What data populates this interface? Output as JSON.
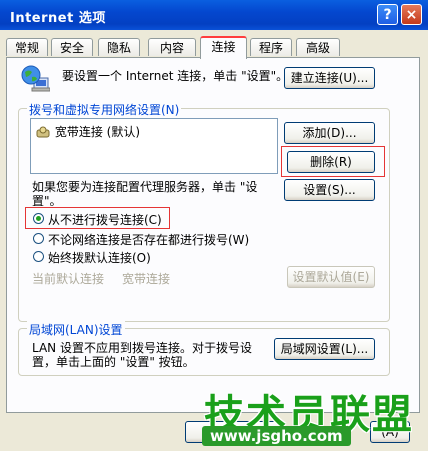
{
  "window": {
    "title": "Internet 选项",
    "help_label": "?",
    "close_label": "×"
  },
  "tabs": [
    {
      "label": "常规"
    },
    {
      "label": "安全"
    },
    {
      "label": "隐私"
    },
    {
      "label": "内容"
    },
    {
      "label": "连接"
    },
    {
      "label": "程序"
    },
    {
      "label": "高级"
    }
  ],
  "connect": {
    "setup_text": "要设置一个 Internet 连接，单击 \"设置\"。",
    "setup_button": "建立连接(U)..."
  },
  "dialup": {
    "group_label": "拨号和虚拟专用网络设置(N)",
    "items": [
      {
        "label": "宽带连接 (默认)"
      }
    ],
    "add_button": "添加(D)...",
    "delete_button": "删除(R)",
    "proxy_text_1": "如果您要为连接配置代理服务器，单击 \"设",
    "proxy_text_2": "置\"。",
    "settings_button": "设置(S)...",
    "radio_never": "从不进行拨号连接(C)",
    "radio_when_no_network": "不论网络连接是否存在都进行拨号(W)",
    "radio_always": "始终拨默认连接(O)",
    "current_default_label": "当前默认连接",
    "current_default_value": "宽带连接",
    "set_default_button": "设置默认值(E)"
  },
  "lan": {
    "group_label": "局域网(LAN)设置",
    "text_1": "LAN 设置不应用到拨号连接。对于拨号设",
    "text_2": "置，单击上面的 \"设置\" 按钮。",
    "button": "局域网设置(L)..."
  },
  "footer": {
    "partial_button": "(A)"
  },
  "watermark": {
    "title": "技术员联盟",
    "url": "www.jsgho.com"
  }
}
